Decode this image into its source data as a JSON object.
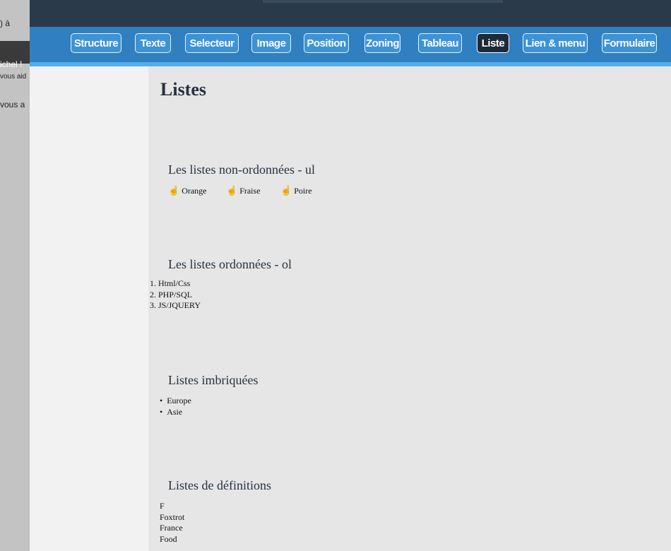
{
  "left_strip": {
    "line1": ") à",
    "line2": "ichel !",
    "line3": "vous aid",
    "line4": "vous a"
  },
  "nav": {
    "items": [
      {
        "label": "Structure"
      },
      {
        "label": "Texte"
      },
      {
        "label": "Selecteur"
      },
      {
        "label": "Image"
      },
      {
        "label": "Position"
      },
      {
        "label": "Zoning"
      },
      {
        "label": "Tableau"
      },
      {
        "label": "Liste",
        "active": true
      },
      {
        "label": "Lien & menu"
      },
      {
        "label": "Formulaire"
      }
    ],
    "colors": {
      "bar": "#2f7fc1",
      "button": "#3d93d6",
      "active": "#1e2a38",
      "accent_line": "#50aee8",
      "topbar": "#2b3a4b"
    }
  },
  "page": {
    "title": "Listes",
    "sections": {
      "ul": {
        "title": "Les listes non-ordonnées - ul",
        "bullet_icon": "hand-pointer-icon",
        "items": [
          "Orange",
          "Fraise",
          "Poire"
        ]
      },
      "ol": {
        "title": "Les listes ordonnées - ol",
        "items": [
          "1. Html/Css",
          "2. PHP/SQL",
          "3. JS/JQUERY"
        ]
      },
      "nested": {
        "title": "Listes imbriquées",
        "items": [
          "Europe",
          "Asie"
        ]
      },
      "dl": {
        "title": "Listes de définitions",
        "items": [
          "F",
          "Foxtrot",
          "France",
          "Food"
        ]
      }
    }
  }
}
